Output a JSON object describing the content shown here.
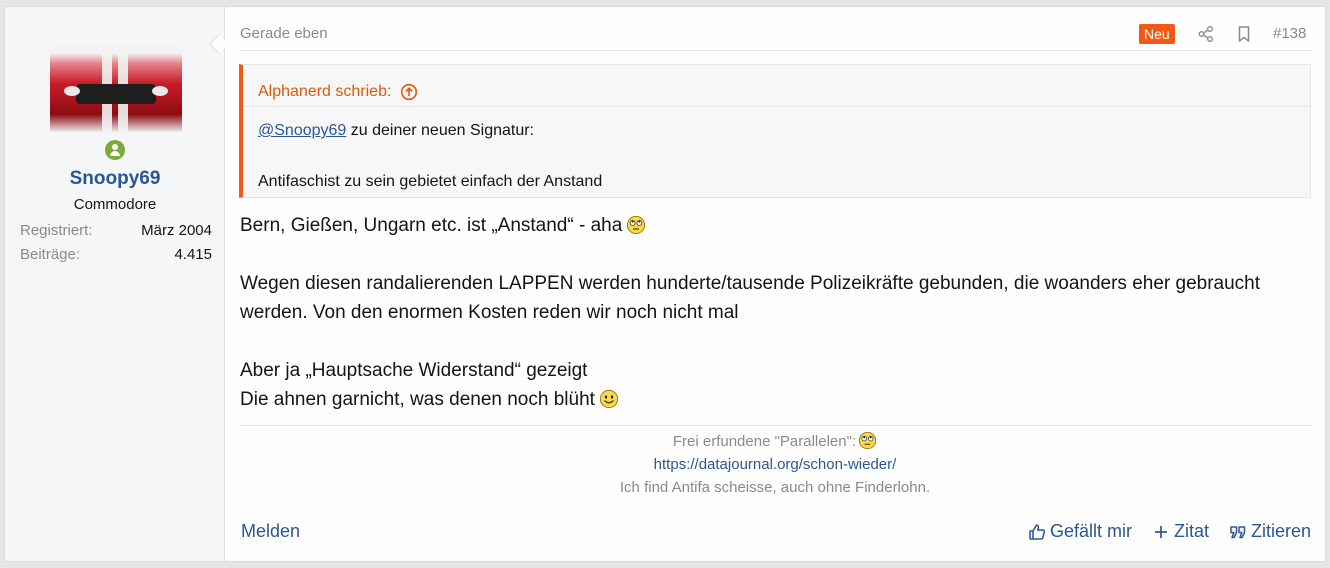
{
  "user": {
    "name": "Snoopy69",
    "title": "Commodore",
    "stats": [
      {
        "label": "Registriert:",
        "value": "März 2004"
      },
      {
        "label": "Beiträge:",
        "value": "4.415"
      }
    ]
  },
  "post": {
    "date": "Gerade eben",
    "badge": "Neu",
    "number": "#138",
    "quote": {
      "author": "Alphanerd schrieb:",
      "mention": "@Snoopy69",
      "line1_rest": " zu deiner neuen Signatur:",
      "line2": "Antifaschist zu sein gebietet einfach der Anstand"
    },
    "content": {
      "line1": "Bern, Gießen, Ungarn etc. ist „Anstand“ - aha",
      "para2": "Wegen diesen randalierenden LAPPEN werden hunderte/tausende Polizeikräfte gebunden, die woanders eher gebraucht werden. Von den enormen Kosten reden wir noch nicht mal",
      "line3": "Aber ja „Hauptsache Widerstand“ gezeigt",
      "line4": "Die ahnen garnicht, was denen noch blüht"
    },
    "signature": {
      "line1": "Frei erfundene \"Parallelen\":",
      "link": "https://datajournal.org/schon-wieder/",
      "line3": "Ich find Antifa scheisse, auch ohne Finderlohn."
    },
    "actions": {
      "report": "Melden",
      "like": "Gefällt mir",
      "plus_quote": "Zitat",
      "reply_quote": "Zitieren"
    }
  },
  "colors": {
    "accent": "#f15a15",
    "link": "#2a5794",
    "muted": "#8a8a8a",
    "online": "#7cab3a"
  }
}
